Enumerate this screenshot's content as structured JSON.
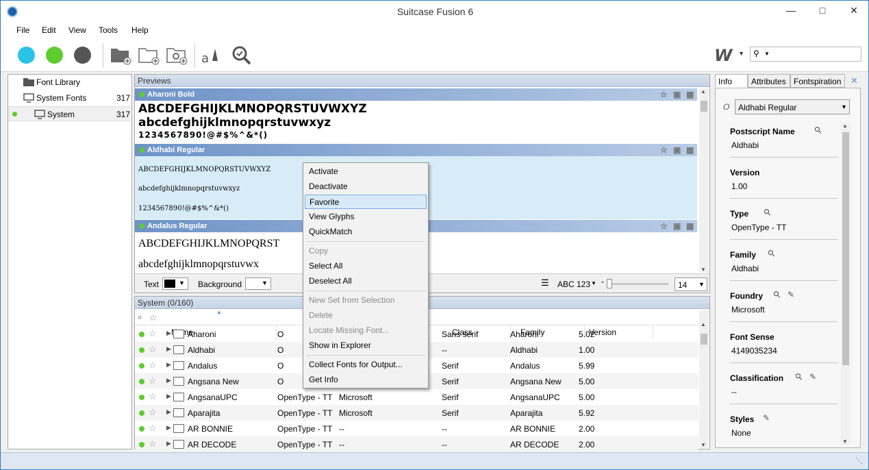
{
  "app": {
    "title": "Suitcase Fusion 6"
  },
  "menu": [
    "File",
    "Edit",
    "View",
    "Tools",
    "Help"
  ],
  "library": [
    {
      "name": "Font Library",
      "count": ""
    },
    {
      "name": "System Fonts",
      "count": "317"
    },
    {
      "name": "System",
      "count": "317"
    }
  ],
  "previews": {
    "title": "Previews",
    "fonts": [
      {
        "name": "Aharoni Bold",
        "upper": "ABCDEFGHIJKLMNOPQRSTUVWXYZ",
        "lower": "abcdefghijklmnopqrstuvwxyz",
        "digits": "1234567890!@#$%^&*()"
      },
      {
        "name": "Aldhabi Regular",
        "upper": "ABCDEFGHIJKLMNOPQRSTUVWXYZ",
        "lower": "abcdefghijklmnopqrstuvwxyz",
        "digits": "1234567890!@#$%^&*()"
      },
      {
        "name": "Andalus Regular",
        "upper": "ABCDEFGHIJKLMNOPQRST",
        "lower": "abcdefghijklmnopqrstuvwx",
        "digits": ""
      }
    ],
    "text_label": "Text",
    "background_label": "Background",
    "abc_label": "ABC 123",
    "size": "14"
  },
  "context_menu": {
    "items": [
      {
        "label": "Activate",
        "disabled": false
      },
      {
        "label": "Deactivate",
        "disabled": false
      },
      {
        "label": "Favorite",
        "disabled": false,
        "highlighted": true
      },
      {
        "label": "View Glyphs",
        "disabled": false
      },
      {
        "label": "QuickMatch",
        "disabled": false
      },
      {
        "label": "Copy",
        "disabled": true
      },
      {
        "label": "Select All",
        "disabled": false
      },
      {
        "label": "Deselect All",
        "disabled": false
      },
      {
        "label": "New Set from Selection",
        "disabled": true
      },
      {
        "label": "Delete",
        "disabled": true
      },
      {
        "label": "Locate Missing Font...",
        "disabled": true
      },
      {
        "label": "Show in Explorer",
        "disabled": false
      },
      {
        "label": "Collect Fonts for Output...",
        "disabled": false
      },
      {
        "label": "Get Info",
        "disabled": false
      }
    ]
  },
  "table": {
    "title": "System (0/160)",
    "columns": {
      "name": "Name",
      "class": "Class",
      "family": "Family",
      "version": "Version"
    },
    "rows": [
      {
        "name": "Aharoni",
        "type": "O",
        "foundry": "",
        "class": "Sans serif",
        "family": "Aharoni",
        "version": "5.02"
      },
      {
        "name": "Aldhabi",
        "type": "O",
        "foundry": "",
        "class": "--",
        "family": "Aldhabi",
        "version": "1.00"
      },
      {
        "name": "Andalus",
        "type": "O",
        "foundry": "",
        "class": "Serif",
        "family": "Andalus",
        "version": "5.99"
      },
      {
        "name": "Angsana New",
        "type": "O",
        "foundry": "",
        "class": "Serif",
        "family": "Angsana New",
        "version": "5.00"
      },
      {
        "name": "AngsanaUPC",
        "type": "OpenType - TT",
        "foundry": "Microsoft",
        "class": "Serif",
        "family": "AngsanaUPC",
        "version": "5.00"
      },
      {
        "name": "Aparajita",
        "type": "OpenType - TT",
        "foundry": "Microsoft",
        "class": "Serif",
        "family": "Aparajita",
        "version": "5.92"
      },
      {
        "name": "AR BONNIE",
        "type": "OpenType - TT",
        "foundry": "--",
        "class": "--",
        "family": "AR BONNIE",
        "version": "2.00"
      },
      {
        "name": "AR DECODE",
        "type": "OpenType - TT",
        "foundry": "--",
        "class": "--",
        "family": "AR DECODE",
        "version": "2.00"
      }
    ]
  },
  "info": {
    "tabs": [
      "Info",
      "Attributes",
      "Fontspiration"
    ],
    "selected_font": "Aldhabi Regular",
    "fields": [
      {
        "label": "Postscript Name",
        "value": "Aldhabi"
      },
      {
        "label": "Version",
        "value": "1.00"
      },
      {
        "label": "Type",
        "value": "OpenType - TT"
      },
      {
        "label": "Family",
        "value": "Aldhabi"
      },
      {
        "label": "Foundry",
        "value": "Microsoft"
      },
      {
        "label": "Font Sense",
        "value": "4149035234"
      },
      {
        "label": "Classification",
        "value": "--"
      },
      {
        "label": "Styles",
        "value": "None"
      }
    ]
  },
  "colors": {
    "green": "#5ecb2f",
    "cyan": "#29c3e6",
    "gray": "#555555",
    "accent": "#2f7dc5"
  }
}
